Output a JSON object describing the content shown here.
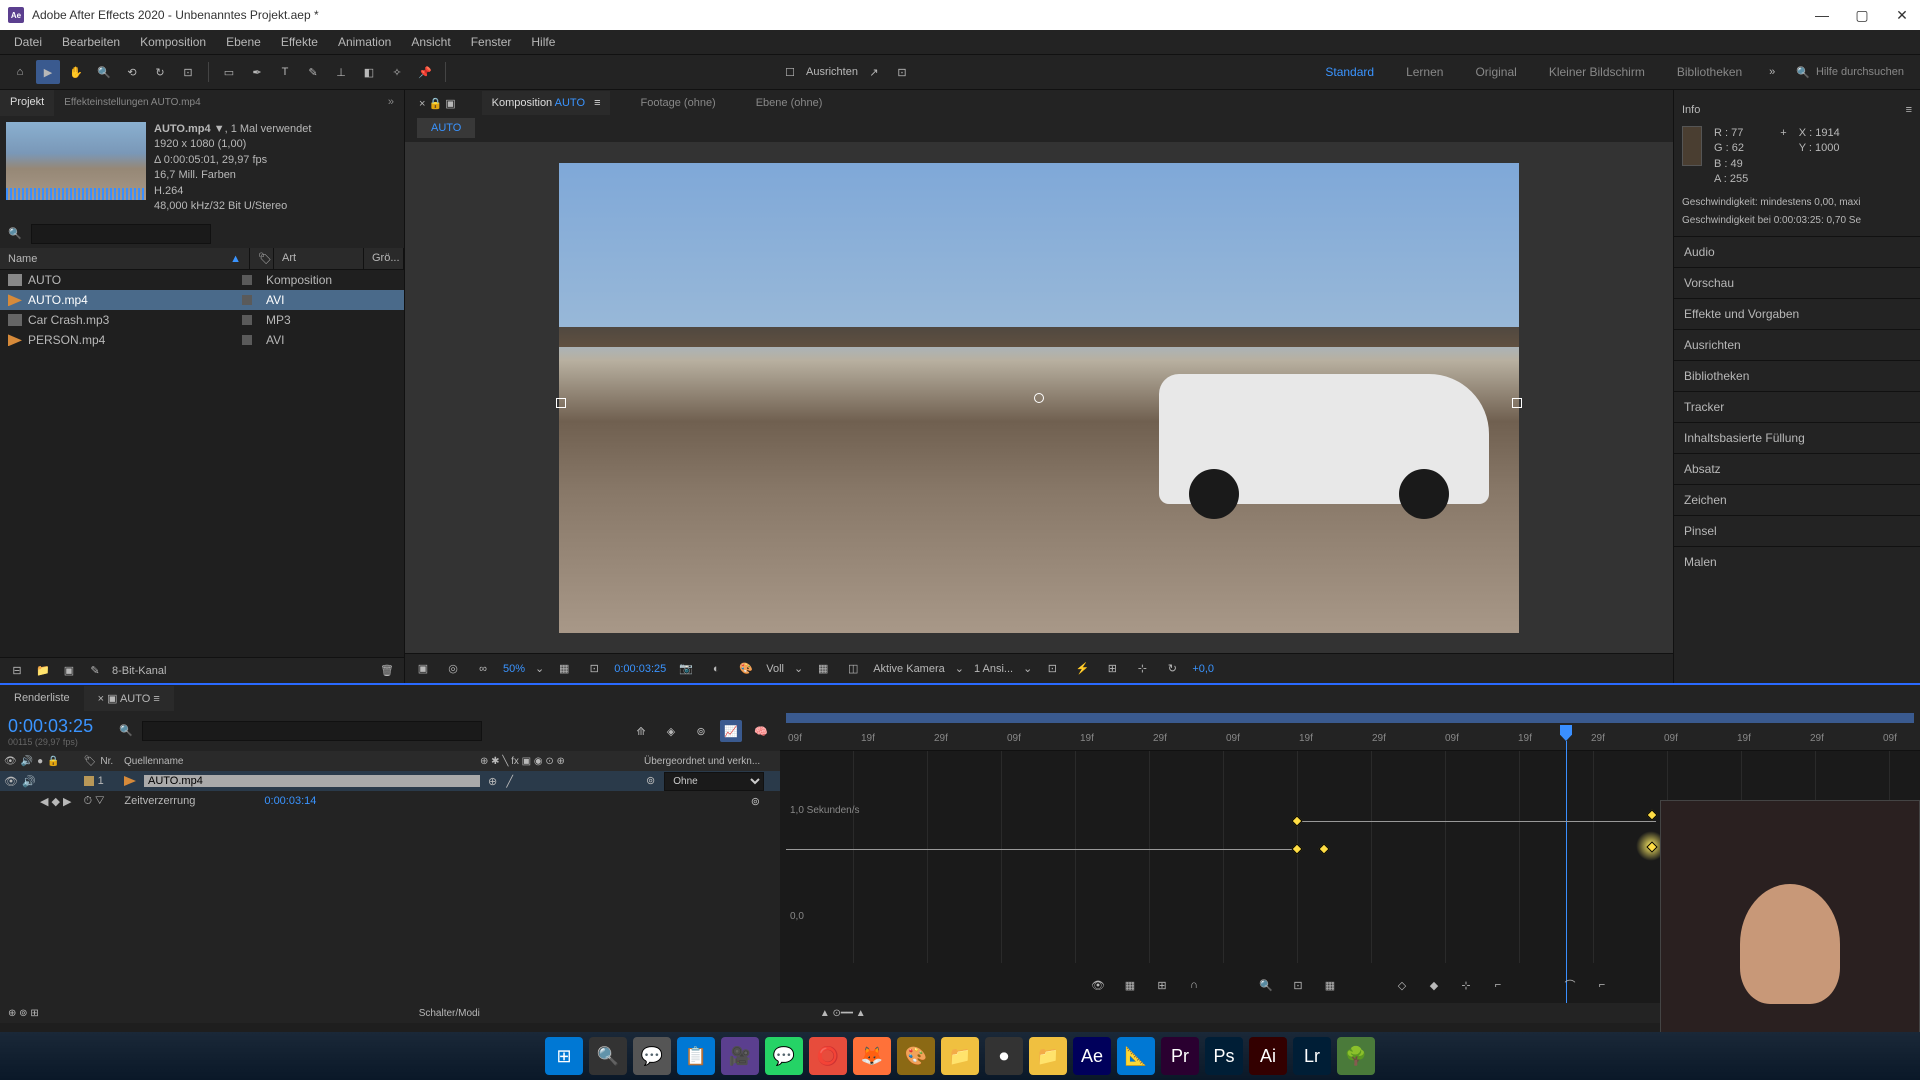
{
  "titlebar": {
    "app": "Ae",
    "title": "Adobe After Effects 2020 - Unbenanntes Projekt.aep *"
  },
  "menubar": [
    "Datei",
    "Bearbeiten",
    "Komposition",
    "Ebene",
    "Effekte",
    "Animation",
    "Ansicht",
    "Fenster",
    "Hilfe"
  ],
  "toolbar": {
    "align_label": "Ausrichten",
    "workspaces": [
      {
        "name": "Standard",
        "active": true
      },
      {
        "name": "Lernen",
        "active": false
      },
      {
        "name": "Original",
        "active": false
      },
      {
        "name": "Kleiner Bildschirm",
        "active": false
      },
      {
        "name": "Bibliotheken",
        "active": false
      }
    ],
    "search_placeholder": "Hilfe durchsuchen"
  },
  "project_panel": {
    "tab_project": "Projekt",
    "tab_effects": "Effekteinstellungen AUTO.mp4",
    "asset_name": "AUTO.mp4 ▼",
    "asset_used": ", 1 Mal verwendet",
    "asset_res": "1920 x 1080 (1,00)",
    "asset_dur": "Δ 0:00:05:01, 29,97 fps",
    "asset_colors": "16,7 Mill. Farben",
    "asset_codec": "H.264",
    "asset_audio": "48,000 kHz/32 Bit U/Stereo",
    "search_placeholder": "",
    "col_name": "Name",
    "col_type": "Art",
    "col_size": "Grö...",
    "rows": [
      {
        "name": "AUTO",
        "type": "Komposition",
        "icon": "comp",
        "selected": false
      },
      {
        "name": "AUTO.mp4",
        "type": "AVI",
        "icon": "avi",
        "selected": true
      },
      {
        "name": "Car Crash.mp3",
        "type": "MP3",
        "icon": "mp3",
        "selected": false
      },
      {
        "name": "PERSON.mp4",
        "type": "AVI",
        "icon": "avi",
        "selected": false
      }
    ],
    "footer_bpc": "8-Bit-Kanal"
  },
  "composition": {
    "tab_comp_prefix": "Komposition",
    "tab_comp_name": "AUTO",
    "tab_footage": "Footage",
    "tab_footage_none": "(ohne)",
    "tab_layer": "Ebene",
    "tab_layer_none": "(ohne)",
    "breadcrumb": "AUTO",
    "zoom": "50%",
    "time": "0:00:03:25",
    "res": "Voll",
    "camera": "Aktive Kamera",
    "views": "1 Ansi...",
    "adjust": "+0,0"
  },
  "info_panel": {
    "header": "Info",
    "r_label": "R :",
    "r_val": "77",
    "g_label": "G :",
    "g_val": "62",
    "b_label": "B :",
    "b_val": "49",
    "a_label": "A :",
    "a_val": "255",
    "x_label": "X :",
    "x_val": "1914",
    "y_label": "Y :",
    "y_val": "1000",
    "speed1": "Geschwindigkeit: mindestens 0,00, maxi",
    "speed2": "Geschwindigkeit bei 0:00:03:25: 0,70 Se"
  },
  "side_panels": [
    "Audio",
    "Vorschau",
    "Effekte und Vorgaben",
    "Ausrichten",
    "Bibliotheken",
    "Tracker",
    "Inhaltsbasierte Füllung",
    "Absatz",
    "Zeichen",
    "Pinsel",
    "Malen"
  ],
  "timeline": {
    "tab_render": "Renderliste",
    "tab_comp": "AUTO",
    "timecode": "0:00:03:25",
    "timecode_sub": "00115 (29,97 fps)",
    "col_nr": "Nr.",
    "col_source": "Quellenname",
    "col_parent": "Übergeordnet und verkn...",
    "layer_num": "1",
    "layer_name": "AUTO.mp4",
    "parent_none": "Ohne",
    "prop_name": "Zeitverzerrung",
    "prop_val": "0:00:03:14",
    "ruler_ticks": [
      "09f",
      "19f",
      "29f",
      "09f",
      "19f",
      "29f",
      "09f",
      "19f",
      "29f",
      "09f",
      "19f",
      "29f",
      "09f",
      "19f",
      "29f",
      "09f"
    ],
    "graph_top_label": "1,0 Sekunden/s",
    "graph_bot_label": "0,0",
    "status_label": "Schalter/Modi"
  },
  "taskbar_icons": [
    "⊞",
    "🔍",
    "💬",
    "📋",
    "🎥",
    "💬",
    "⭕",
    "🦊",
    "🎨",
    "📁",
    "⏺",
    "📁",
    "Ae",
    "📐",
    "Pr",
    "Ps",
    "Ai",
    "Lr",
    "🌳"
  ]
}
